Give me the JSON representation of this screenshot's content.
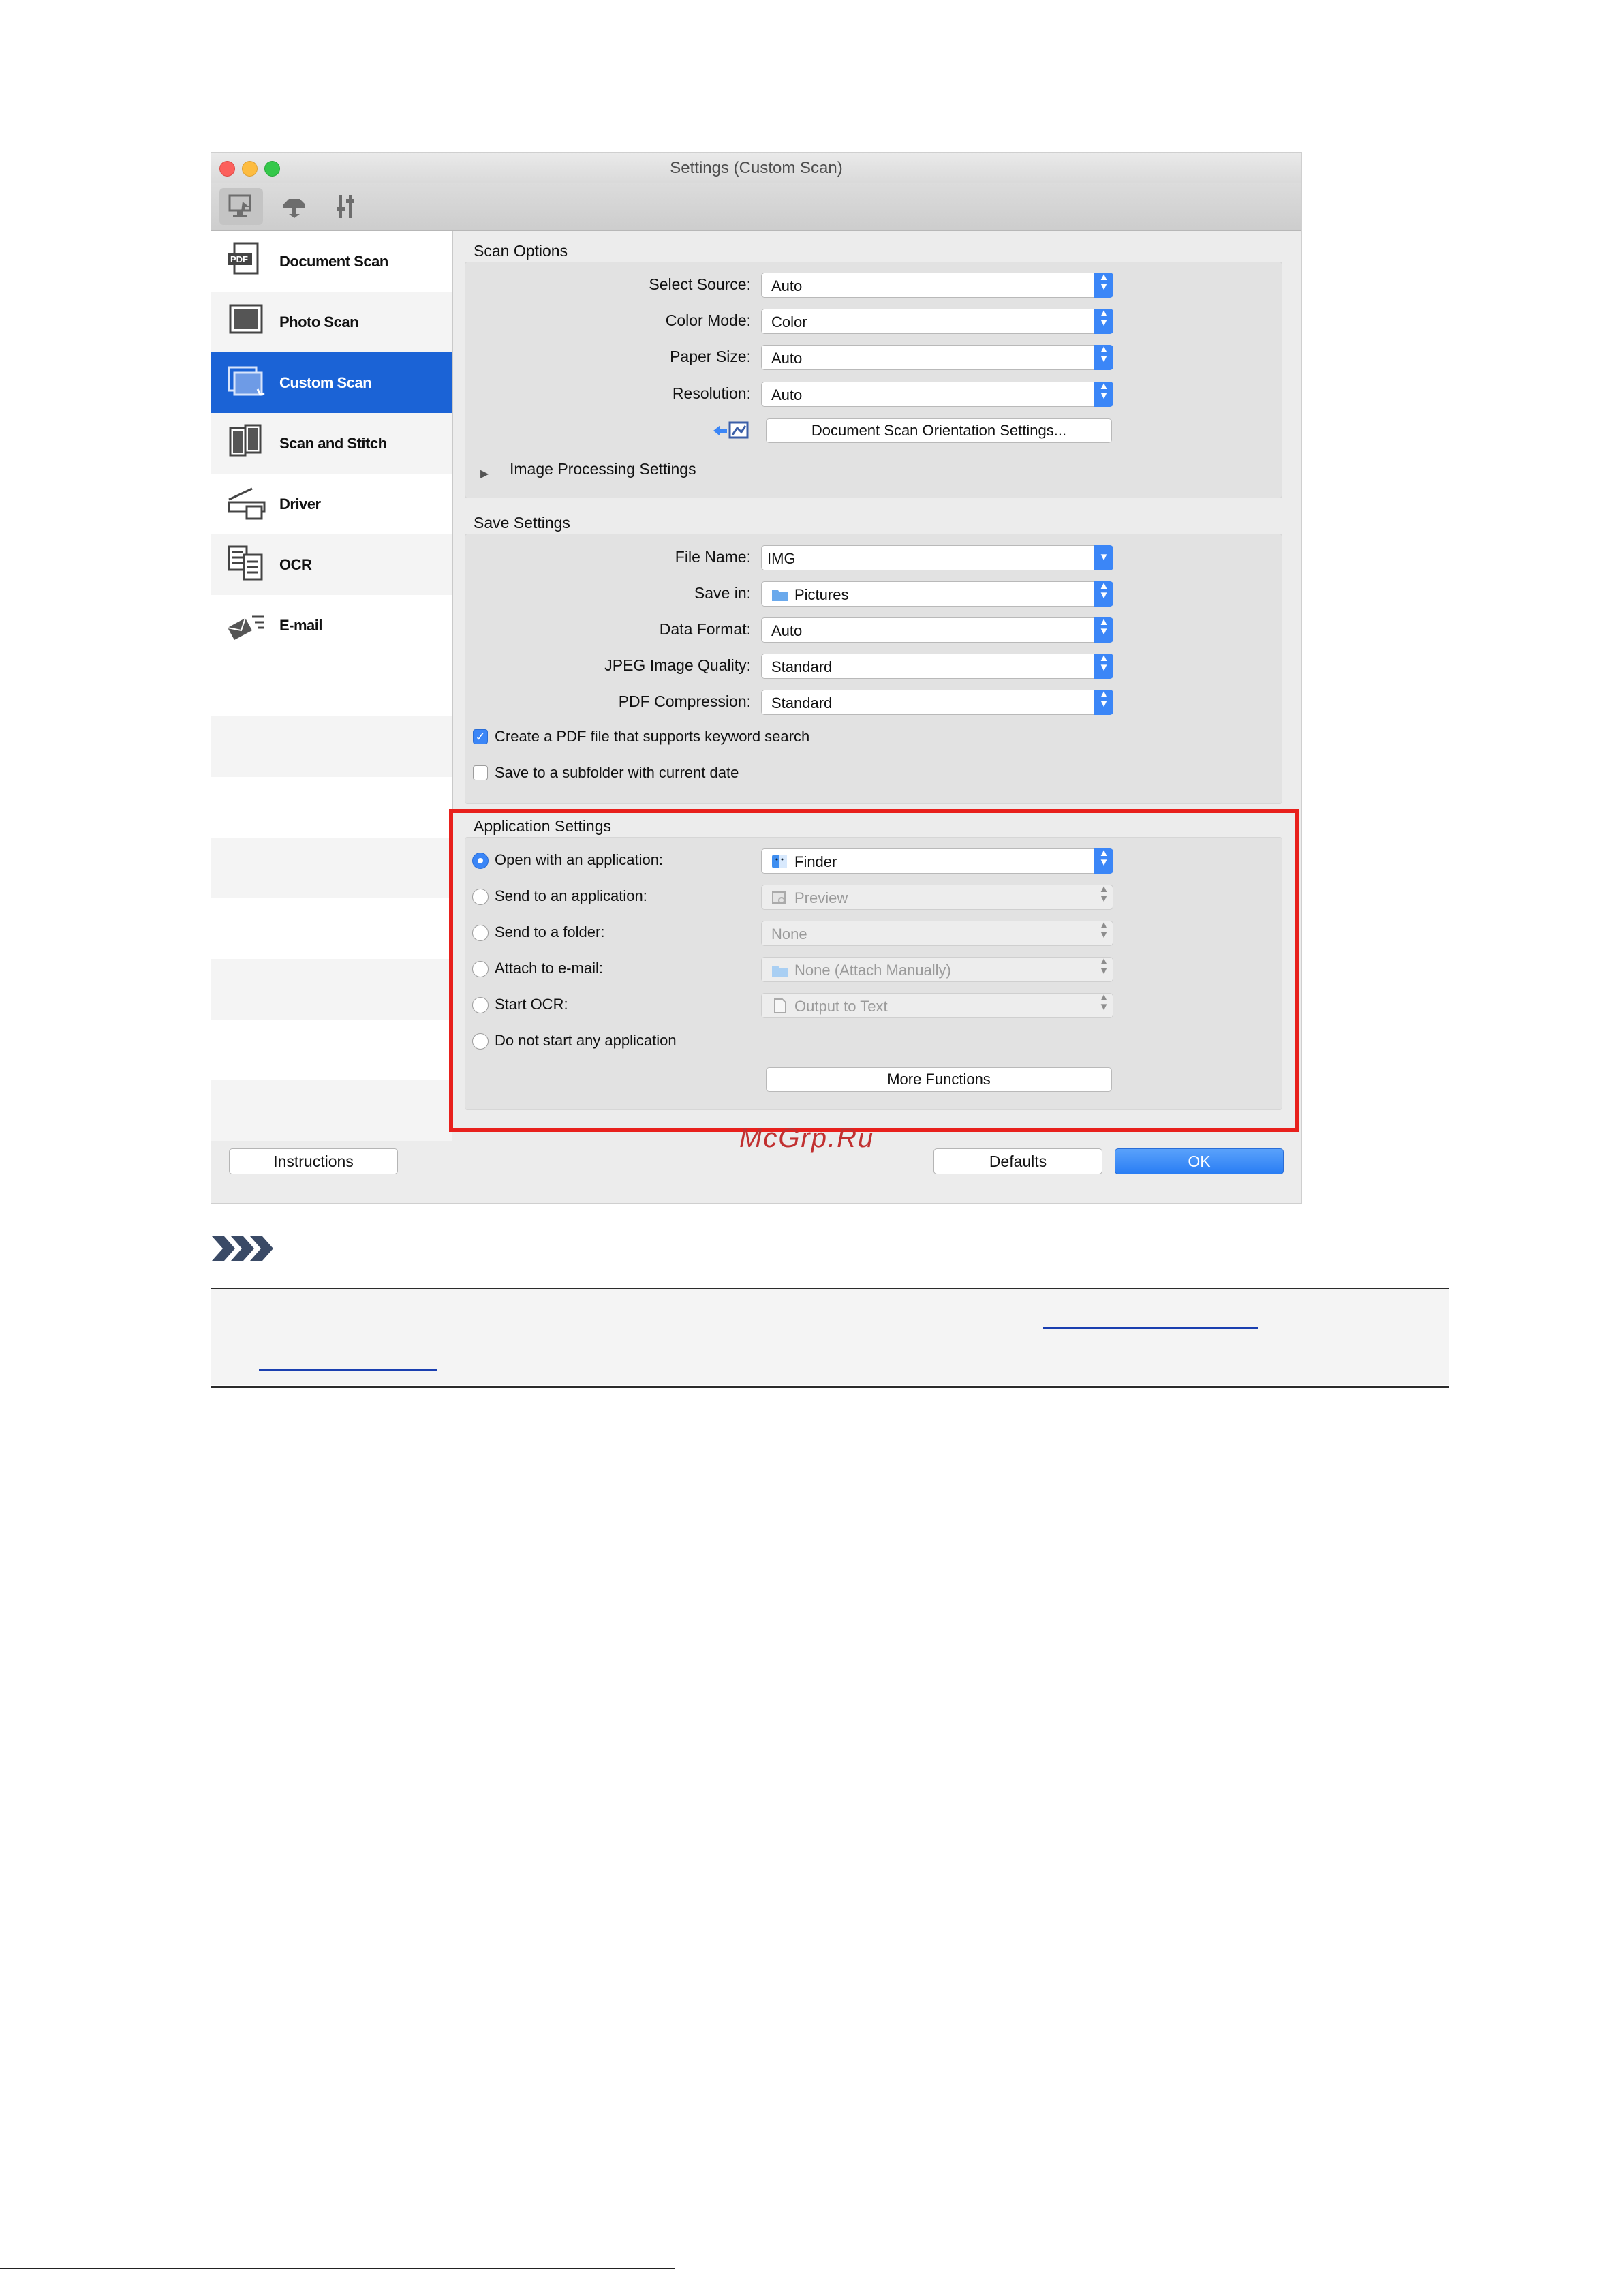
{
  "window": {
    "title": "Settings (Custom Scan)"
  },
  "toolbar": {
    "tabs": [
      "scan-from-computer",
      "scan-from-operation-panel",
      "general-settings"
    ]
  },
  "sidebar": {
    "items": [
      {
        "label": "Document Scan",
        "icon": "pdf-document-icon"
      },
      {
        "label": "Photo Scan",
        "icon": "photo-icon"
      },
      {
        "label": "Custom Scan",
        "icon": "custom-scan-icon",
        "selected": true
      },
      {
        "label": "Scan and Stitch",
        "icon": "stitch-icon"
      },
      {
        "label": "Driver",
        "icon": "scanner-driver-icon"
      },
      {
        "label": "OCR",
        "icon": "ocr-icon"
      },
      {
        "label": "E-mail",
        "icon": "email-icon"
      }
    ]
  },
  "scan_options": {
    "title": "Scan Options",
    "select_source": {
      "label": "Select Source:",
      "value": "Auto"
    },
    "color_mode": {
      "label": "Color Mode:",
      "value": "Color"
    },
    "paper_size": {
      "label": "Paper Size:",
      "value": "Auto"
    },
    "resolution": {
      "label": "Resolution:",
      "value": "Auto"
    },
    "orientation_button": "Document Scan Orientation Settings...",
    "image_processing": "Image Processing Settings"
  },
  "save_settings": {
    "title": "Save Settings",
    "file_name": {
      "label": "File Name:",
      "value": "IMG"
    },
    "save_in": {
      "label": "Save in:",
      "value": "Pictures"
    },
    "data_format": {
      "label": "Data Format:",
      "value": "Auto"
    },
    "jpeg_quality": {
      "label": "JPEG Image Quality:",
      "value": "Standard"
    },
    "pdf_compression": {
      "label": "PDF Compression:",
      "value": "Standard"
    },
    "keyword_search": {
      "label": "Create a PDF file that supports keyword search",
      "checked": true
    },
    "subfolder": {
      "label": "Save to a subfolder with current date",
      "checked": false
    }
  },
  "application_settings": {
    "title": "Application Settings",
    "open_app": {
      "label": "Open with an application:",
      "value": "Finder",
      "selected": true
    },
    "send_app": {
      "label": "Send to an application:",
      "value": "Preview"
    },
    "send_folder": {
      "label": "Send to a folder:",
      "value": "None"
    },
    "attach_email": {
      "label": "Attach to e-mail:",
      "value": "None (Attach Manually)"
    },
    "start_ocr": {
      "label": "Start OCR:",
      "value": "Output to Text"
    },
    "no_app": {
      "label": "Do not start any application"
    },
    "more_functions": "More Functions"
  },
  "buttons": {
    "instructions": "Instructions",
    "defaults": "Defaults",
    "ok": "OK"
  },
  "watermark": "McGrp.Ru",
  "colors": {
    "highlight": "#e8201c",
    "accent": "#3b86f7",
    "selection": "#1b63d6"
  }
}
